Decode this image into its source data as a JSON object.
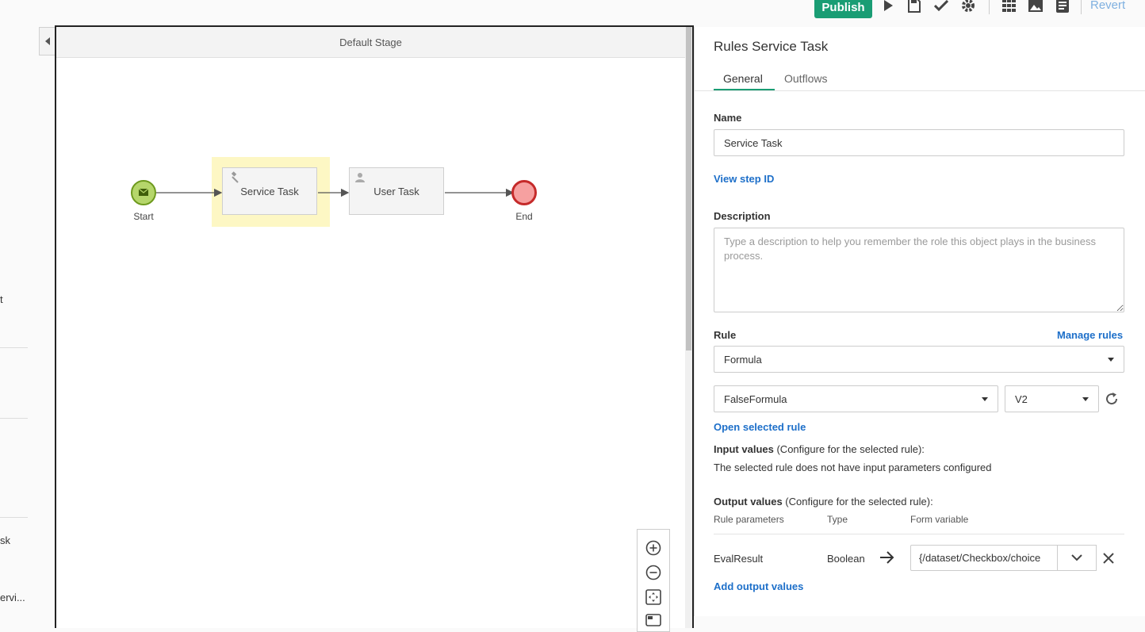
{
  "toolbar": {
    "publish_label": "Publish",
    "revert_label": "Revert",
    "icons": [
      "play-icon",
      "save-icon",
      "check-icon",
      "gear-icon",
      "grid-icon",
      "image-icon",
      "document-icon"
    ]
  },
  "left_strip": {
    "fragments": [
      "t",
      "sk",
      "ervi..."
    ]
  },
  "canvas": {
    "stage_title": "Default Stage",
    "nodes": {
      "start_label": "Start",
      "service_task_label": "Service Task",
      "user_task_label": "User Task",
      "end_label": "End"
    }
  },
  "panel": {
    "title": "Rules Service Task",
    "tabs": [
      {
        "label": "General",
        "active": true
      },
      {
        "label": "Outflows",
        "active": false
      }
    ],
    "name_label": "Name",
    "name_value": "Service Task",
    "view_step_id": "View step ID",
    "description_label": "Description",
    "description_placeholder": "Type a description to help you remember the role this object plays in the business process.",
    "rule_label": "Rule",
    "manage_rules": "Manage rules",
    "rule_type": "Formula",
    "rule_name": "FalseFormula",
    "rule_version": "V2",
    "open_selected_rule": "Open selected rule",
    "input_values_label": "Input values",
    "input_values_hint": " (Configure for the selected rule):",
    "input_values_message": "The selected rule does not have input parameters configured",
    "output_values_label": "Output values",
    "output_values_hint": " (Configure for the selected rule):",
    "output_columns": [
      "Rule parameters",
      "Type",
      "Form variable"
    ],
    "output_rows": [
      {
        "parameter": "EvalResult",
        "type": "Boolean",
        "form_variable": "{/dataset/Checkbox/choice"
      }
    ],
    "add_output_values": "Add output values"
  },
  "colors": {
    "accent": "#1a9d74",
    "link": "#1d6fc9",
    "highlight": "#fdf7c4",
    "start_fill": "#b5d66b",
    "end_fill": "#f6a0a0",
    "end_stroke": "#c52a2a"
  }
}
